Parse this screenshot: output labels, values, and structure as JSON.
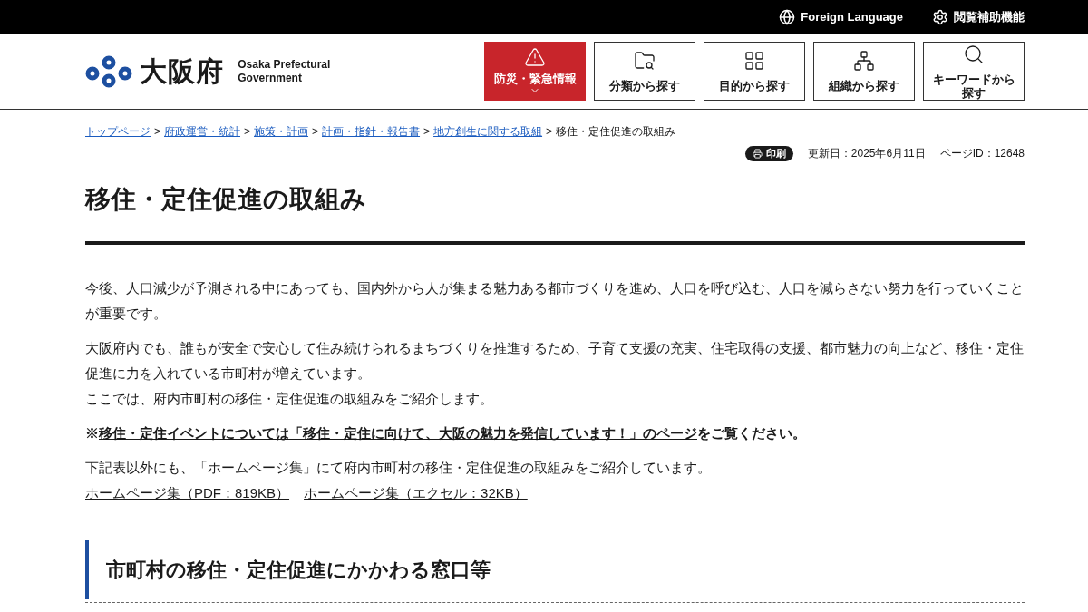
{
  "top_bar": {
    "links": [
      {
        "kind": "globe",
        "label": "Foreign Language"
      },
      {
        "kind": "gear",
        "label": "閲覧補助機能"
      }
    ]
  },
  "header": {
    "logo_text": "大阪府",
    "logo_subtitle": [
      "Osaka Prefectural",
      "Government"
    ],
    "nav": [
      {
        "kind": "emergency",
        "label": "防災・緊急情報"
      },
      {
        "kind": "folder",
        "label": "分類から探す"
      },
      {
        "kind": "grid",
        "label": "目的から探す"
      },
      {
        "kind": "org",
        "label": "組織から探す"
      },
      {
        "kind": "search",
        "label": "キーワードから探す"
      }
    ]
  },
  "breadcrumb": {
    "links": [
      "トップページ",
      "府政運営・統計",
      "施策・計画",
      "計画・指針・報告書",
      "地方創生に関する取組"
    ],
    "current": "移住・定住促進の取組み",
    "separator": ">"
  },
  "meta": {
    "print": "印刷",
    "updated": "更新日：2025年6月11日",
    "page_id": "ページID：12648"
  },
  "title": "移住・定住促進の取組み",
  "paragraphs": [
    [
      "今後、人口減少が予測される中にあっても、国内外から人が集まる魅力ある都市づくりを進め、人口を呼び込む、人口を減らさない努力を行っていくことが重要です。"
    ],
    [
      "大阪府内でも、誰もが安全で安心して住み続けられるまちづくりを推進するため、子育て支援の充実、住宅取得の支援、都市魅力の向上など、移住・定住促進に力を入れている市町村が増えています。",
      "ここでは、府内市町村の移住・定住促進の取組みをご紹介します。"
    ]
  ],
  "notice": {
    "prefix": "※",
    "link": "移住・定住イベントについては「移住・定住に向けて、大阪の魅力を発信しています！」のページ",
    "suffix": "をご覧ください。"
  },
  "downloads": {
    "text": "下記表以外にも、「ホームページ集」にて府内市町村の移住・定住促進の取組みをご紹介しています。",
    "links": [
      "ホームページ集（PDF：819KB）",
      "ホームページ集（エクセル：32KB）"
    ]
  },
  "section_heading": "市町村の移住・定住促進にかかわる窓口等"
}
